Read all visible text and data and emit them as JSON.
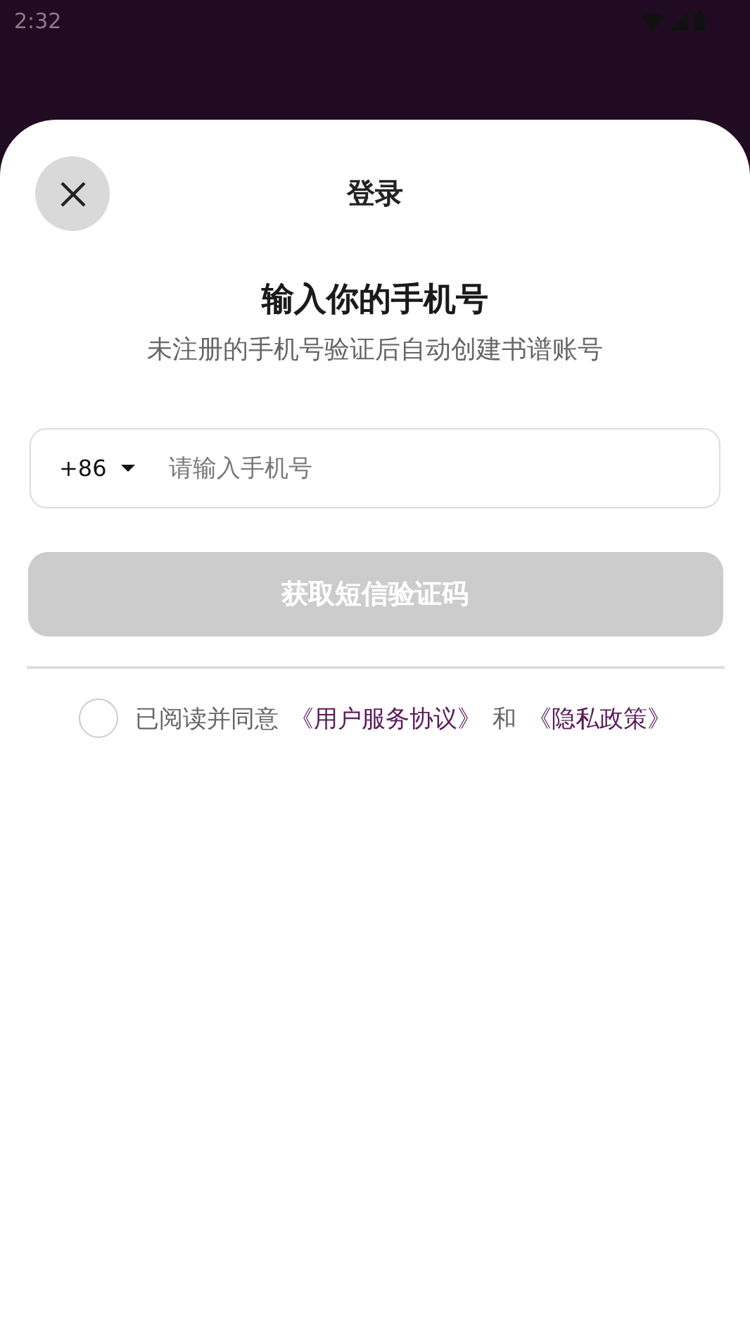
{
  "status_bar": {
    "time": "2:32"
  },
  "sheet": {
    "title": "登录"
  },
  "heading": "输入你的手机号",
  "subtitle": "未注册的手机号验证后自动创建书谱账号",
  "phone_field": {
    "country_code": "+86",
    "placeholder": "请输入手机号"
  },
  "submit_button": {
    "label": "获取短信验证码",
    "disabled": true
  },
  "agreement": {
    "checked": false,
    "parts": [
      {
        "kind": "text",
        "text": "已阅读并同意"
      },
      {
        "kind": "link",
        "text": "《用户服务协议》"
      },
      {
        "kind": "text",
        "text": "和"
      },
      {
        "kind": "link",
        "text": "《隐私政策》"
      }
    ]
  }
}
